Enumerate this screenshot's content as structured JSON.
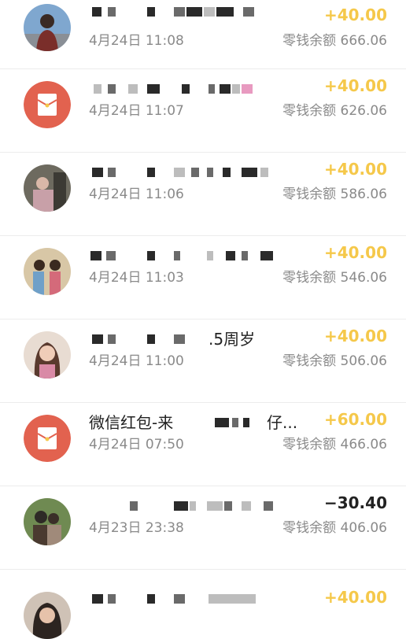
{
  "balance_label": "零钱余额",
  "colors": {
    "income": "#f5c84a",
    "expense": "#222222",
    "redpacket": "#e2624f"
  },
  "transactions": [
    {
      "avatar": "user-photo",
      "title": "",
      "time": "4月24日 11:08",
      "amount": "+40.00",
      "balance": "666.06"
    },
    {
      "avatar": "red-packet-icon",
      "title": "",
      "time": "4月24日 11:07",
      "amount": "+40.00",
      "balance": "626.06"
    },
    {
      "avatar": "user-photo",
      "title": "",
      "time": "4月24日 11:06",
      "amount": "+40.00",
      "balance": "586.06"
    },
    {
      "avatar": "user-photo",
      "title": "",
      "time": "4月24日 11:03",
      "amount": "+40.00",
      "balance": "546.06"
    },
    {
      "avatar": "user-photo",
      "title": ".5周岁",
      "time": "4月24日 11:00",
      "amount": "+40.00",
      "balance": "506.06"
    },
    {
      "avatar": "red-packet-icon",
      "title": "微信红包-来",
      "title_suffix": "仔...",
      "time": "4月24日 07:50",
      "amount": "+60.00",
      "balance": "466.06"
    },
    {
      "avatar": "user-photo",
      "title": "",
      "time": "4月23日 23:38",
      "amount": "−30.40",
      "balance": "406.06"
    },
    {
      "avatar": "user-photo",
      "title": "",
      "time": "",
      "amount": "+40.00",
      "balance": ""
    }
  ]
}
